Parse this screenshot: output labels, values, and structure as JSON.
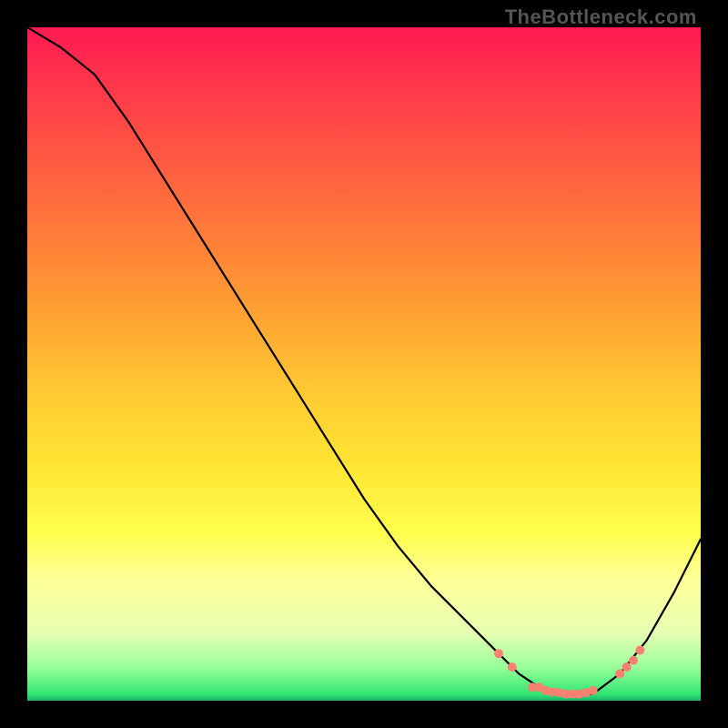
{
  "watermark": "TheBottleneck.com",
  "chart_data": {
    "type": "line",
    "title": "",
    "xlabel": "",
    "ylabel": "",
    "xlim": [
      0,
      100
    ],
    "ylim": [
      0,
      100
    ],
    "grid": false,
    "legend": false,
    "background": "red-yellow-green-vertical-gradient",
    "curve": {
      "description": "Single black V-shaped bottleneck curve. High at left edge, descends past mid-right to a flat minimum near x≈80, then rises toward the right edge.",
      "x": [
        0,
        5,
        10,
        15,
        20,
        25,
        30,
        35,
        40,
        45,
        50,
        55,
        60,
        65,
        70,
        73,
        76,
        80,
        84,
        88,
        92,
        96,
        100
      ],
      "y": [
        100,
        97,
        93,
        86,
        78,
        70,
        62,
        54,
        46,
        38,
        30,
        23,
        17,
        12,
        7,
        4,
        2,
        1,
        1,
        4,
        9,
        16,
        24
      ]
    },
    "markers": {
      "description": "Salmon-colored dots clustered along the valley of the curve",
      "color": "#fa8072",
      "points": [
        {
          "x": 70,
          "y": 7
        },
        {
          "x": 72,
          "y": 5
        },
        {
          "x": 75,
          "y": 2
        },
        {
          "x": 76,
          "y": 2
        },
        {
          "x": 77,
          "y": 1.5
        },
        {
          "x": 78,
          "y": 1.3
        },
        {
          "x": 79,
          "y": 1.2
        },
        {
          "x": 80,
          "y": 1
        },
        {
          "x": 81,
          "y": 1
        },
        {
          "x": 82,
          "y": 1
        },
        {
          "x": 83,
          "y": 1.2
        },
        {
          "x": 84,
          "y": 1.5
        },
        {
          "x": 88,
          "y": 4
        },
        {
          "x": 89,
          "y": 5
        },
        {
          "x": 90,
          "y": 6
        },
        {
          "x": 91,
          "y": 7.5
        }
      ]
    }
  }
}
